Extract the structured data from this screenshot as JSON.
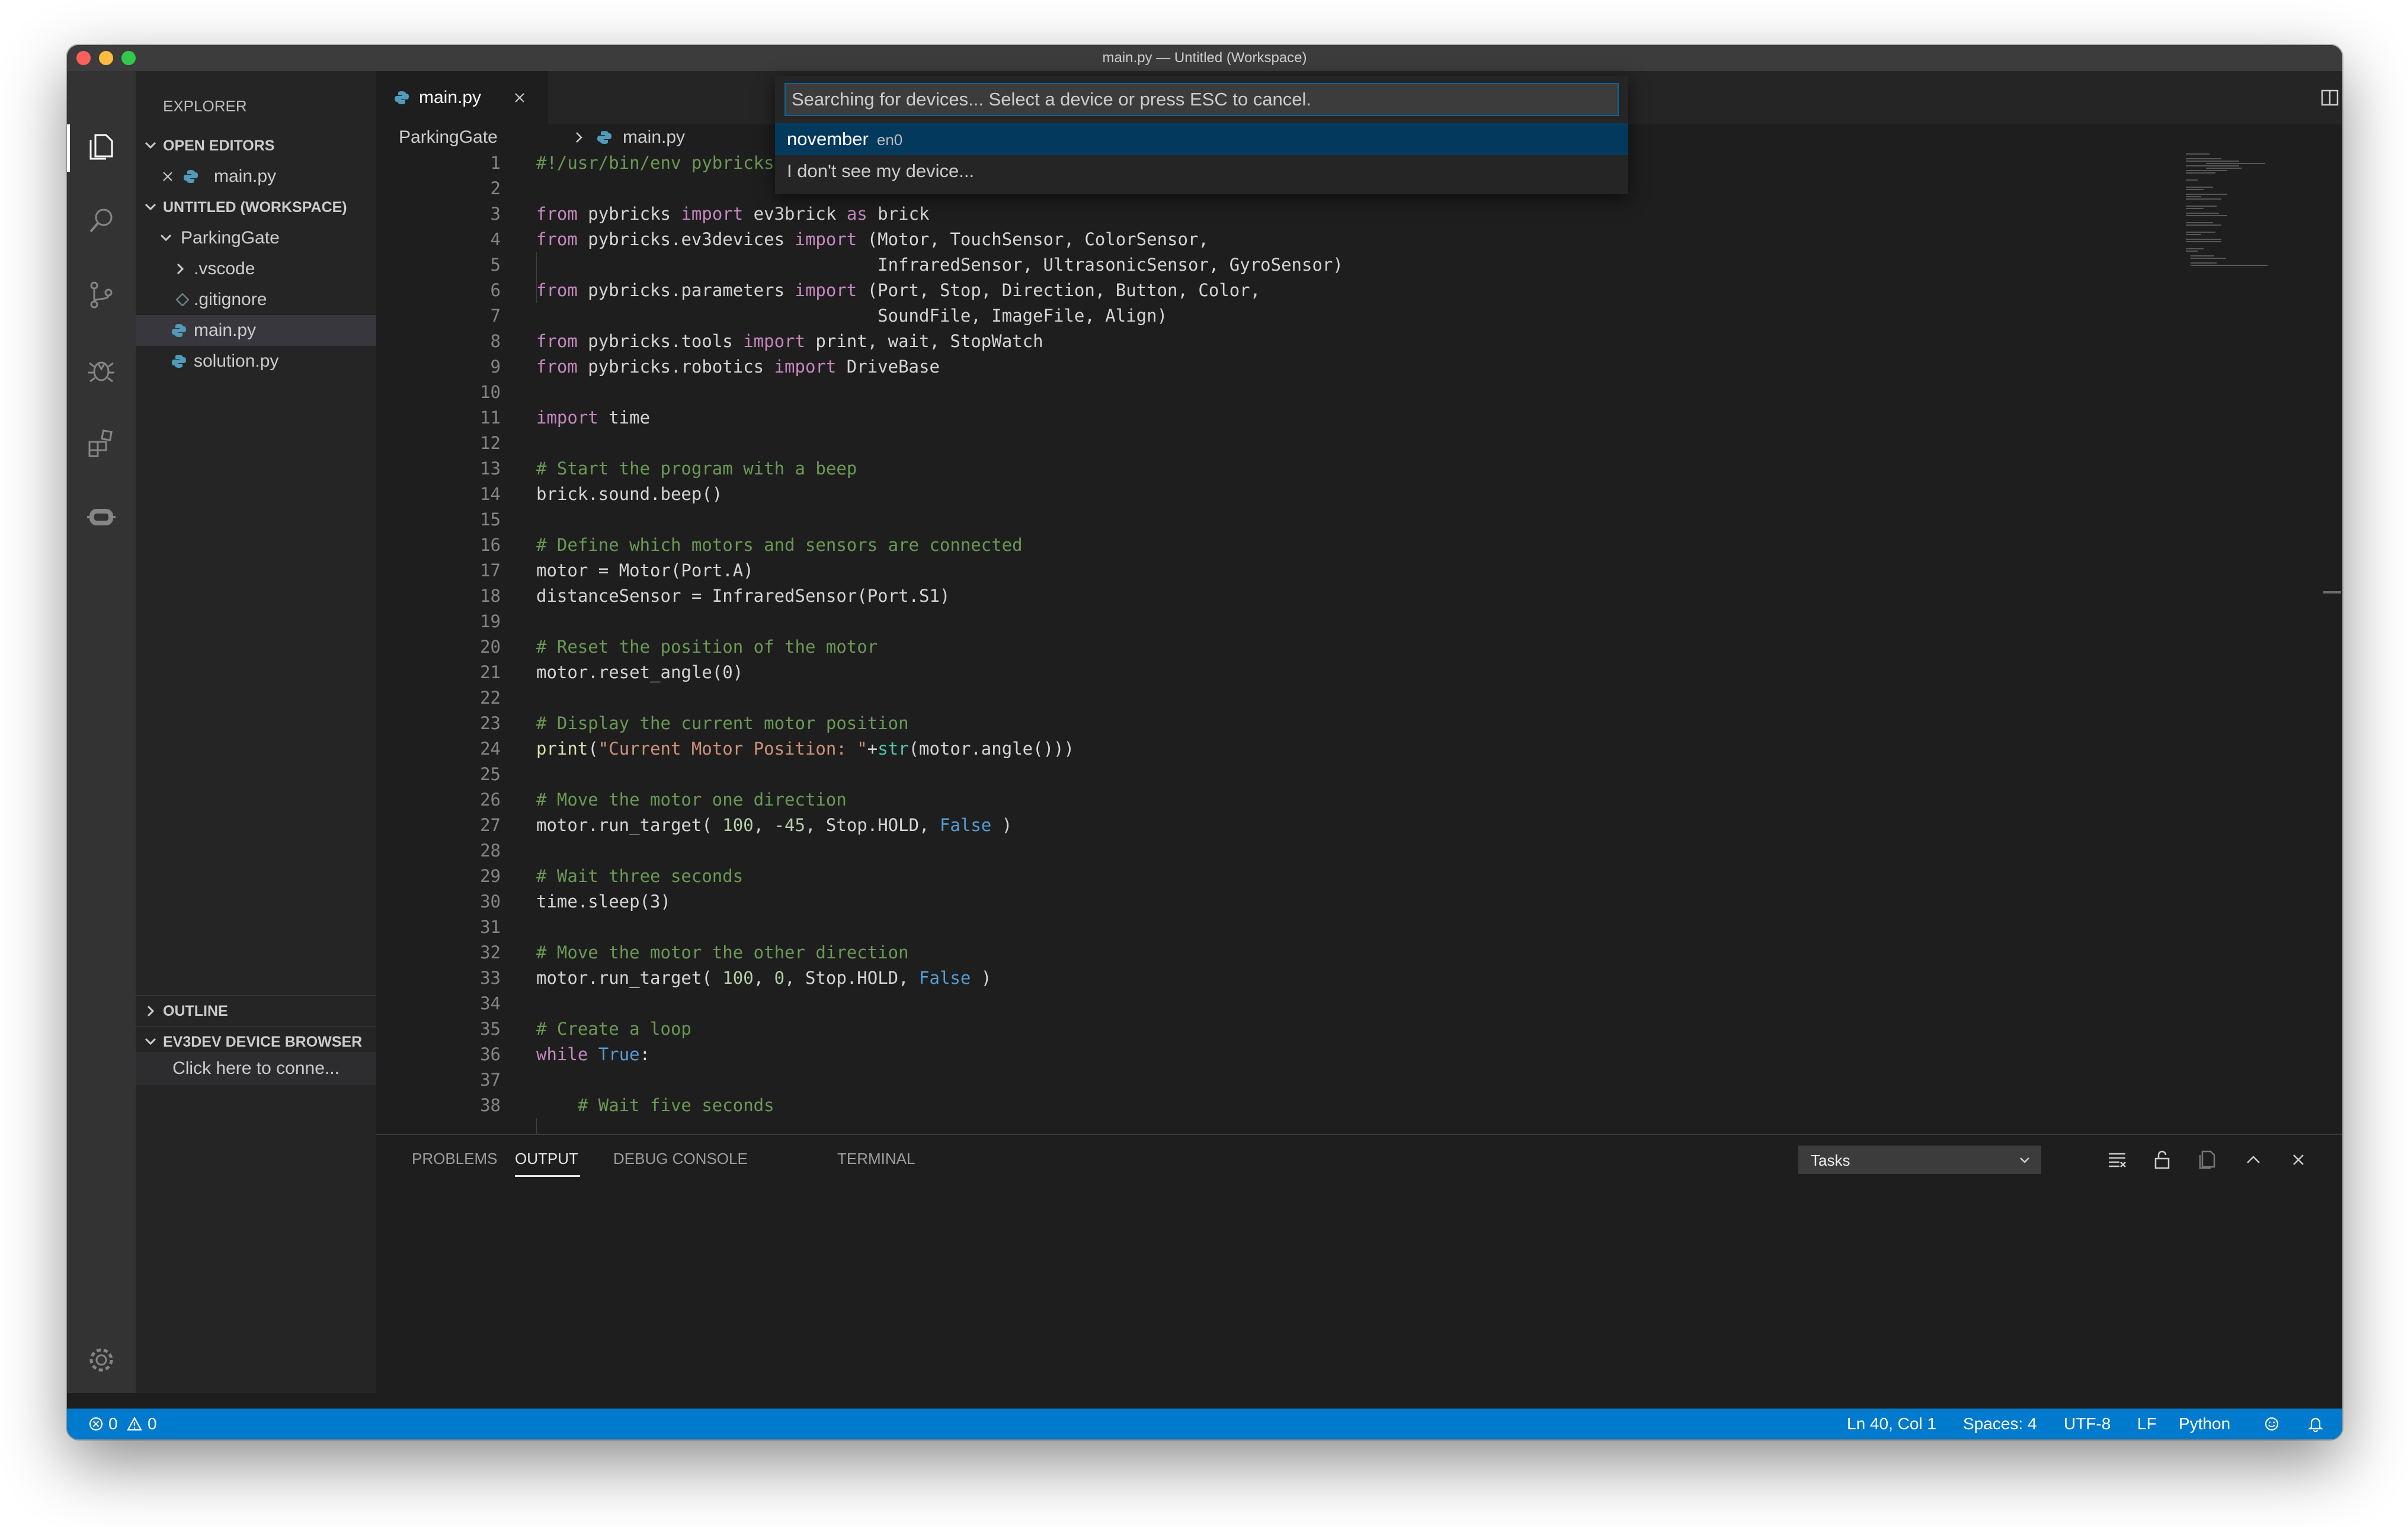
{
  "window": {
    "title": "main.py — Untitled (Workspace)"
  },
  "sidebar": {
    "title": "EXPLORER",
    "open_editors": {
      "label": "OPEN EDITORS",
      "items": [
        {
          "name": "main.py"
        }
      ]
    },
    "workspace": {
      "label": "UNTITLED (WORKSPACE)",
      "folder": "ParkingGate",
      "items": [
        ".vscode",
        ".gitignore",
        "main.py",
        "solution.py"
      ]
    },
    "outline": "OUTLINE",
    "ev3dev": {
      "label": "EV3DEV DEVICE BROWSER",
      "connect": "Click here to conne..."
    }
  },
  "editor": {
    "tab": "main.py",
    "breadcrumb": [
      "ParkingGate",
      "main.py"
    ],
    "line_numbers": [
      "1",
      "2",
      "3",
      "4",
      "5",
      "6",
      "7",
      "8",
      "9",
      "10",
      "11",
      "12",
      "13",
      "14",
      "15",
      "16",
      "17",
      "18",
      "19",
      "20",
      "21",
      "22",
      "23",
      "24",
      "25",
      "26",
      "27",
      "28",
      "29",
      "30",
      "31",
      "32",
      "33",
      "34",
      "35",
      "36",
      "37",
      "38"
    ],
    "code_lines": [
      "#!/usr/bin/env pybricks-microp",
      "",
      "from pybricks import ev3brick as brick",
      "from pybricks.ev3devices import (Motor, TouchSensor, ColorSensor,",
      "                                 InfraredSensor, UltrasonicSensor, GyroSensor)",
      "from pybricks.parameters import (Port, Stop, Direction, Button, Color,",
      "                                 SoundFile, ImageFile, Align)",
      "from pybricks.tools import print, wait, StopWatch",
      "from pybricks.robotics import DriveBase",
      "",
      "import time",
      "",
      "# Start the program with a beep",
      "brick.sound.beep()",
      "",
      "# Define which motors and sensors are connected",
      "motor = Motor(Port.A)",
      "distanceSensor = InfraredSensor(Port.S1)",
      "",
      "# Reset the position of the motor",
      "motor.reset_angle(0)",
      "",
      "# Display the current motor position",
      "print(\"Current Motor Position: \"+str(motor.angle()))",
      "",
      "# Move the motor one direction",
      "motor.run_target( 100, -45, Stop.HOLD, False )",
      "",
      "# Wait three seconds",
      "time.sleep(3)",
      "",
      "# Move the motor the other direction",
      "motor.run_target( 100, 0, Stop.HOLD, False )",
      "",
      "# Create a loop",
      "while True:",
      "",
      "    # Wait five seconds"
    ]
  },
  "quickpick": {
    "placeholder": "Searching for devices... Select a device or press ESC to cancel.",
    "items": [
      {
        "label": "november",
        "desc": "en0"
      },
      {
        "label": "I don't see my device...",
        "desc": ""
      }
    ]
  },
  "panel": {
    "tabs": [
      "PROBLEMS",
      "OUTPUT",
      "DEBUG CONSOLE",
      "TERMINAL"
    ],
    "select_value": "Tasks"
  },
  "status": {
    "errors": "0",
    "warnings": "0",
    "position": "Ln 40, Col 1",
    "spaces": "Spaces: 4",
    "encoding": "UTF-8",
    "eol": "LF",
    "language": "Python"
  },
  "colors": {
    "accent": "#007acc",
    "python_icon": "#519aba",
    "comment": "#6a9955",
    "keyword": "#c586c0",
    "string": "#ce9178"
  }
}
